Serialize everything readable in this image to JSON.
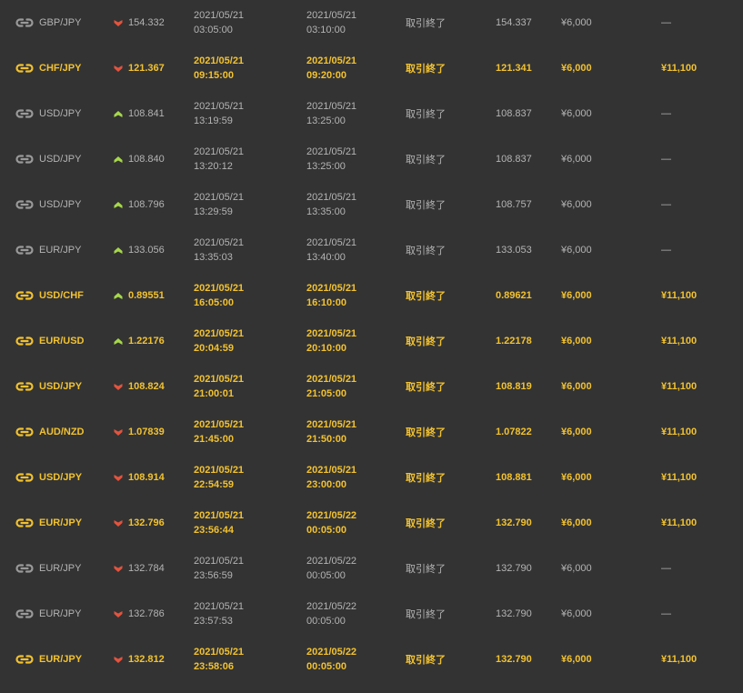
{
  "colors": {
    "background": "#333333",
    "win_text": "#f2c230",
    "lose_text": "#b4b4b4",
    "arrow_up": "#a6d84a",
    "arrow_down": "#e5533d",
    "icon_win": "#f2c230",
    "icon_lose": "#9a9a9a"
  },
  "rows": [
    {
      "result": "lose",
      "pair": "GBP/JPY",
      "direction": "down",
      "entry_rate": "154.332",
      "start_date": "2021/05/21",
      "start_time": "03:05:00",
      "end_date": "2021/05/21",
      "end_time": "03:10:00",
      "status": "取引終了",
      "close_rate": "154.337",
      "amount": "¥6,000",
      "payout": "—"
    },
    {
      "result": "win",
      "pair": "CHF/JPY",
      "direction": "down",
      "entry_rate": "121.367",
      "start_date": "2021/05/21",
      "start_time": "09:15:00",
      "end_date": "2021/05/21",
      "end_time": "09:20:00",
      "status": "取引終了",
      "close_rate": "121.341",
      "amount": "¥6,000",
      "payout": "¥11,100"
    },
    {
      "result": "lose",
      "pair": "USD/JPY",
      "direction": "up",
      "entry_rate": "108.841",
      "start_date": "2021/05/21",
      "start_time": "13:19:59",
      "end_date": "2021/05/21",
      "end_time": "13:25:00",
      "status": "取引終了",
      "close_rate": "108.837",
      "amount": "¥6,000",
      "payout": "—"
    },
    {
      "result": "lose",
      "pair": "USD/JPY",
      "direction": "up",
      "entry_rate": "108.840",
      "start_date": "2021/05/21",
      "start_time": "13:20:12",
      "end_date": "2021/05/21",
      "end_time": "13:25:00",
      "status": "取引終了",
      "close_rate": "108.837",
      "amount": "¥6,000",
      "payout": "—"
    },
    {
      "result": "lose",
      "pair": "USD/JPY",
      "direction": "up",
      "entry_rate": "108.796",
      "start_date": "2021/05/21",
      "start_time": "13:29:59",
      "end_date": "2021/05/21",
      "end_time": "13:35:00",
      "status": "取引終了",
      "close_rate": "108.757",
      "amount": "¥6,000",
      "payout": "—"
    },
    {
      "result": "lose",
      "pair": "EUR/JPY",
      "direction": "up",
      "entry_rate": "133.056",
      "start_date": "2021/05/21",
      "start_time": "13:35:03",
      "end_date": "2021/05/21",
      "end_time": "13:40:00",
      "status": "取引終了",
      "close_rate": "133.053",
      "amount": "¥6,000",
      "payout": "—"
    },
    {
      "result": "win",
      "pair": "USD/CHF",
      "direction": "up",
      "entry_rate": "0.89551",
      "start_date": "2021/05/21",
      "start_time": "16:05:00",
      "end_date": "2021/05/21",
      "end_time": "16:10:00",
      "status": "取引終了",
      "close_rate": "0.89621",
      "amount": "¥6,000",
      "payout": "¥11,100"
    },
    {
      "result": "win",
      "pair": "EUR/USD",
      "direction": "up",
      "entry_rate": "1.22176",
      "start_date": "2021/05/21",
      "start_time": "20:04:59",
      "end_date": "2021/05/21",
      "end_time": "20:10:00",
      "status": "取引終了",
      "close_rate": "1.22178",
      "amount": "¥6,000",
      "payout": "¥11,100"
    },
    {
      "result": "win",
      "pair": "USD/JPY",
      "direction": "down",
      "entry_rate": "108.824",
      "start_date": "2021/05/21",
      "start_time": "21:00:01",
      "end_date": "2021/05/21",
      "end_time": "21:05:00",
      "status": "取引終了",
      "close_rate": "108.819",
      "amount": "¥6,000",
      "payout": "¥11,100"
    },
    {
      "result": "win",
      "pair": "AUD/NZD",
      "direction": "down",
      "entry_rate": "1.07839",
      "start_date": "2021/05/21",
      "start_time": "21:45:00",
      "end_date": "2021/05/21",
      "end_time": "21:50:00",
      "status": "取引終了",
      "close_rate": "1.07822",
      "amount": "¥6,000",
      "payout": "¥11,100"
    },
    {
      "result": "win",
      "pair": "USD/JPY",
      "direction": "down",
      "entry_rate": "108.914",
      "start_date": "2021/05/21",
      "start_time": "22:54:59",
      "end_date": "2021/05/21",
      "end_time": "23:00:00",
      "status": "取引終了",
      "close_rate": "108.881",
      "amount": "¥6,000",
      "payout": "¥11,100"
    },
    {
      "result": "win",
      "pair": "EUR/JPY",
      "direction": "down",
      "entry_rate": "132.796",
      "start_date": "2021/05/21",
      "start_time": "23:56:44",
      "end_date": "2021/05/22",
      "end_time": "00:05:00",
      "status": "取引終了",
      "close_rate": "132.790",
      "amount": "¥6,000",
      "payout": "¥11,100"
    },
    {
      "result": "lose",
      "pair": "EUR/JPY",
      "direction": "down",
      "entry_rate": "132.784",
      "start_date": "2021/05/21",
      "start_time": "23:56:59",
      "end_date": "2021/05/22",
      "end_time": "00:05:00",
      "status": "取引終了",
      "close_rate": "132.790",
      "amount": "¥6,000",
      "payout": "—"
    },
    {
      "result": "lose",
      "pair": "EUR/JPY",
      "direction": "down",
      "entry_rate": "132.786",
      "start_date": "2021/05/21",
      "start_time": "23:57:53",
      "end_date": "2021/05/22",
      "end_time": "00:05:00",
      "status": "取引終了",
      "close_rate": "132.790",
      "amount": "¥6,000",
      "payout": "—"
    },
    {
      "result": "win",
      "pair": "EUR/JPY",
      "direction": "down",
      "entry_rate": "132.812",
      "start_date": "2021/05/21",
      "start_time": "23:58:06",
      "end_date": "2021/05/22",
      "end_time": "00:05:00",
      "status": "取引終了",
      "close_rate": "132.790",
      "amount": "¥6,000",
      "payout": "¥11,100"
    }
  ]
}
